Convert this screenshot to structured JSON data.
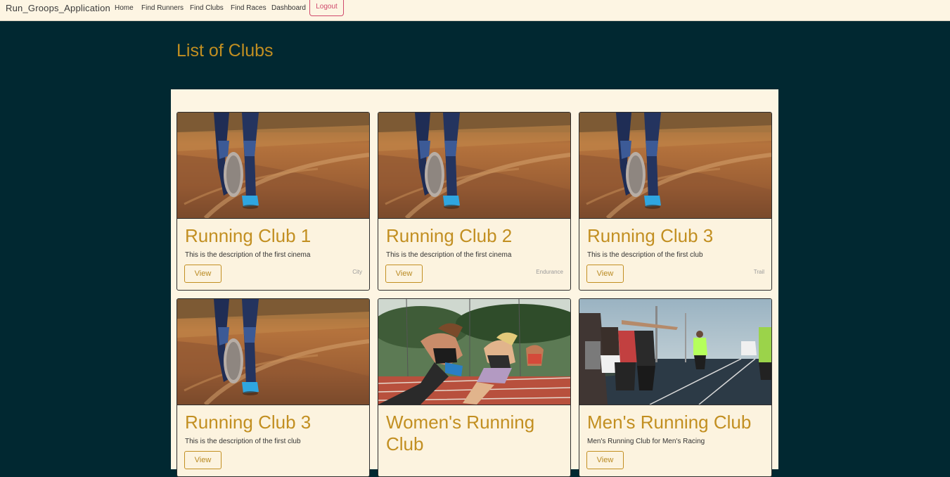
{
  "navbar": {
    "brand": "Run_Groops_Application",
    "links": [
      "Home",
      "Find Runners",
      "Find Clubs",
      "Find Races",
      "Dashboard"
    ],
    "logout": "Logout"
  },
  "page": {
    "title": "List of Clubs"
  },
  "clubs": [
    {
      "title": "Running Club 1",
      "description": "This is the description of the first cinema",
      "view": "View",
      "category": "City",
      "image": "runner-legs-dirt-road"
    },
    {
      "title": "Running Club 2",
      "description": "This is the description of the first cinema",
      "view": "View",
      "category": "Endurance",
      "image": "runner-legs-dirt-road"
    },
    {
      "title": "Running Club 3",
      "description": "This is the description of the first club",
      "view": "View",
      "category": "Trail",
      "image": "runner-legs-dirt-road"
    },
    {
      "title": "Running Club 3",
      "description": "This is the description of the first club",
      "view": "View",
      "category": "",
      "image": "runner-legs-dirt-road"
    },
    {
      "title": "Women's Running Club",
      "description": "",
      "view": "View",
      "category": "",
      "image": "women-sprinting-track"
    },
    {
      "title": "Men's Running Club",
      "description": "Men's Running Club for Men's Racing",
      "view": "View",
      "category": "",
      "image": "men-high-five-track"
    }
  ],
  "colors": {
    "background": "#012831",
    "navbar": "#fdf5e3",
    "accent": "#c28f21",
    "logout": "#d0496c",
    "panel": "#fdf5e3"
  }
}
